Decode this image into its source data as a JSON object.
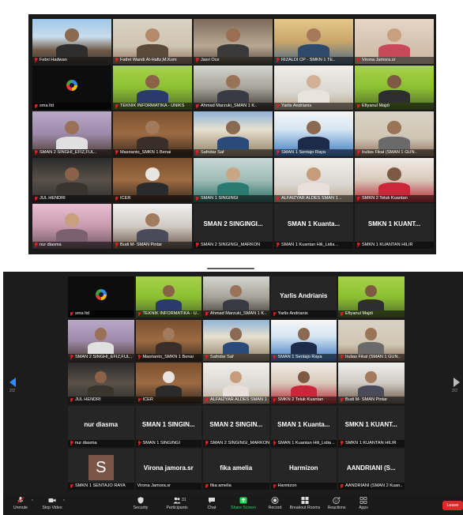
{
  "top_grid": [
    {
      "name": "Febri Hadwan",
      "muted": true,
      "type": "video",
      "bg": "bg-dock",
      "skin": "#8a6a50",
      "shirt": "#2e2e2e",
      "spotlight": true
    },
    {
      "name": "Fathri Wandi Al-Hafiz,M.Kom",
      "muted": true,
      "type": "video",
      "bg": "bg-office",
      "skin": "#b58a6a",
      "shirt": "#5a4a3a"
    },
    {
      "name": "Jasri Oce",
      "muted": true,
      "type": "video",
      "bg": "bg-room",
      "skin": "#9a6e52",
      "shirt": "#3a3a3a"
    },
    {
      "name": "RIZALDI CP - SMKN 1 TE..",
      "muted": true,
      "type": "video",
      "bg": "bg-class",
      "skin": "#a57a5a",
      "shirt": "#2d4a6a"
    },
    {
      "name": "Virona Jamora.sr",
      "muted": true,
      "type": "video",
      "bg": "bg-hijab",
      "skin": "#c9a07f",
      "shirt": "#c74a5a"
    },
    {
      "name": "sma ltd",
      "muted": true,
      "type": "logo",
      "bg": "bg-black"
    },
    {
      "name": "TEKNIK INFORMATIKA - UNIKS",
      "muted": true,
      "type": "video",
      "bg": "bg-green",
      "skin": "#8a6248",
      "shirt": "#2a3a6a"
    },
    {
      "name": "Ahmad Marzuki_SMAN 1 K..",
      "muted": true,
      "type": "video",
      "bg": "bg-photo-room",
      "skin": "#9a7258",
      "shirt": "#3a3a44"
    },
    {
      "name": "Yarlis Andrianis",
      "muted": true,
      "type": "video",
      "bg": "bg-white-room",
      "skin": "#d2b096",
      "shirt": "#e8e4dc"
    },
    {
      "name": "Efiyanul Majdi",
      "muted": true,
      "type": "video",
      "bg": "bg-green",
      "skin": "#7e5a42",
      "shirt": "#2e2e30"
    },
    {
      "name": "SMAN 2 SINGHI_EFIZ,FUL..",
      "muted": true,
      "type": "video",
      "bg": "bg-purple",
      "skin": "#9a7058",
      "shirt": "#e0e0e0"
    },
    {
      "name": "Masrianto_SMKN 1 Benai",
      "muted": true,
      "type": "video",
      "bg": "bg-wood",
      "skin": "#a27a5c",
      "shirt": "#3a2e28"
    },
    {
      "name": "Safridar Saf",
      "muted": true,
      "type": "video",
      "bg": "bg-school",
      "skin": "#8a6a52",
      "shirt": "#2a4a7a"
    },
    {
      "name": "SMAN 1 Sentajo Raya",
      "muted": true,
      "type": "video",
      "bg": "bg-slide",
      "skin": "#8c6a52",
      "shirt": "#1e2a4a"
    },
    {
      "name": "Irulias Fikal (SMAN 1 GUN..",
      "muted": true,
      "type": "video",
      "bg": "bg-office",
      "skin": "#9a7456",
      "shirt": "#6a6a6a"
    },
    {
      "name": "JUL HENDRI",
      "muted": true,
      "type": "video",
      "bg": "bg-yellow-shirt",
      "skin": "#8a6248",
      "shirt": "#3a342e"
    },
    {
      "name": "ICER",
      "muted": true,
      "type": "video",
      "bg": "bg-wood",
      "skin": "#e8e4e0",
      "shirt": "#2a2a2a"
    },
    {
      "name": "SMAN 1 SINGINGI",
      "muted": true,
      "type": "video",
      "bg": "bg-teal",
      "skin": "#c9a584",
      "shirt": "#2a7a70"
    },
    {
      "name": "ALFAIZYAR ALDES SMAN 1 ..",
      "muted": true,
      "type": "video",
      "bg": "bg-white-room",
      "skin": "#c69c7c",
      "shirt": "#e8e0d8"
    },
    {
      "name": "SMKN 2 Teluk Kuantan",
      "muted": true,
      "type": "video",
      "bg": "bg-red",
      "skin": "#7e5a44",
      "shirt": "#c8283a"
    },
    {
      "name": "nur diasma",
      "muted": true,
      "type": "video",
      "bg": "bg-pink",
      "skin": "#c9a07e",
      "shirt": "#7a6070"
    },
    {
      "name": "Budi M- SMAN Pintar",
      "muted": true,
      "type": "video",
      "bg": "bg-couple",
      "skin": "#a27a5e",
      "shirt": "#4a4a5a"
    },
    {
      "name": "SMAN 2 SINGINGI_MARKON",
      "muted": true,
      "type": "text",
      "title": "SMAN 2 SINGINGI..."
    },
    {
      "name": "SMAN 1 Kuantan Hili_Lidia ..",
      "muted": true,
      "type": "text",
      "title": "SMAN 1 Kuanta..."
    },
    {
      "name": "SMKN 1 KUANTAN HILIR",
      "muted": true,
      "type": "text",
      "title": "SMKN 1 KUANT..."
    }
  ],
  "bottom_grid": [
    {
      "name": "sma ltd",
      "muted": true,
      "type": "logo",
      "bg": "bg-black"
    },
    {
      "name": "TEKNIK INFORMATIKA - U..",
      "muted": true,
      "type": "video",
      "bg": "bg-green",
      "skin": "#8a6248",
      "shirt": "#2a3a6a"
    },
    {
      "name": "Ahmad Marzuki_SMAN 1 K..",
      "muted": true,
      "type": "video",
      "bg": "bg-photo-room",
      "skin": "#9a7258",
      "shirt": "#3a3a44"
    },
    {
      "name": "Yarlis Andrianis",
      "muted": true,
      "type": "text",
      "title": "Yarlis Andrianis"
    },
    {
      "name": "Efiyanul Majdi",
      "muted": true,
      "type": "video",
      "bg": "bg-green",
      "skin": "#7e5a42",
      "shirt": "#2e2e30"
    },
    {
      "name": "SMAN 2 SINGHI_EFIZ,FUL..",
      "muted": true,
      "type": "video",
      "bg": "bg-purple",
      "skin": "#9a7058",
      "shirt": "#e0e0e0"
    },
    {
      "name": "Masrianto_SMKN 1 Benai",
      "muted": true,
      "type": "video",
      "bg": "bg-wood",
      "skin": "#a27a5c",
      "shirt": "#3a2e28"
    },
    {
      "name": "Safridar Saf",
      "muted": true,
      "type": "video",
      "bg": "bg-school",
      "skin": "#8a6a52",
      "shirt": "#2a4a7a"
    },
    {
      "name": "SMAN 1 Sentajo Raya",
      "muted": true,
      "type": "video",
      "bg": "bg-slide",
      "skin": "#8c6a52",
      "shirt": "#1e2a4a"
    },
    {
      "name": "Irulias Fikal (SMAN 1 GUN..",
      "muted": true,
      "type": "video",
      "bg": "bg-office",
      "skin": "#9a7456",
      "shirt": "#6a6a6a"
    },
    {
      "name": "JUL HENDRI",
      "muted": true,
      "type": "video",
      "bg": "bg-yellow-shirt",
      "skin": "#8a6248",
      "shirt": "#3a342e"
    },
    {
      "name": "ICER",
      "muted": true,
      "type": "video",
      "bg": "bg-wood",
      "skin": "#e8e4e0",
      "shirt": "#2a2a2a"
    },
    {
      "name": "ALFAIZYAR ALDES SMAN 1 ..",
      "muted": true,
      "type": "video",
      "bg": "bg-white-room",
      "skin": "#c69c7c",
      "shirt": "#e8e0d8"
    },
    {
      "name": "SMKN 2 Teluk Kuantan",
      "muted": true,
      "type": "video",
      "bg": "bg-red",
      "skin": "#7e5a44",
      "shirt": "#c8283a"
    },
    {
      "name": "Budi M- SMAN Pintar",
      "muted": true,
      "type": "video",
      "bg": "bg-couple",
      "skin": "#a27a5e",
      "shirt": "#4a4a5a"
    },
    {
      "name": "nur diasma",
      "muted": true,
      "type": "text",
      "title": "nur diasma"
    },
    {
      "name": "SMAN 1 SINGINGI",
      "muted": true,
      "type": "text",
      "title": "SMAN 1 SINGIN..."
    },
    {
      "name": "SMAN 2 SINGINGI_MARKON",
      "muted": true,
      "type": "text",
      "title": "SMAN 2 SINGIN..."
    },
    {
      "name": "SMAN 1 Kuantan Hili_Lidia ..",
      "muted": true,
      "type": "text",
      "title": "SMAN 1 Kuanta..."
    },
    {
      "name": "SMKN 1 KUANTAN HILIR",
      "muted": true,
      "type": "text",
      "title": "SMKN 1 KUANT..."
    },
    {
      "name": "SMKN 1 SENTAJO RAYA",
      "muted": true,
      "type": "avatar",
      "initial": "S"
    },
    {
      "name": "Virona Jamora.sr",
      "muted": false,
      "type": "text",
      "title": "Virona jamora.sr"
    },
    {
      "name": "fika amelia",
      "muted": true,
      "type": "text",
      "title": "fika amelia"
    },
    {
      "name": "Harmizon",
      "muted": true,
      "type": "text",
      "title": "Harmizon"
    },
    {
      "name": "AANDRIANI (SMAN 2 Kuan..",
      "muted": true,
      "type": "text",
      "title": "AANDRIANI (S..."
    }
  ],
  "page_indicator": {
    "left": "2/2",
    "right": "2/2"
  },
  "toolbar": {
    "unmute": "Unmute",
    "stop_video": "Stop Video",
    "security": "Security",
    "participants": "Participants",
    "participants_count": "31",
    "chat": "Chat",
    "share_screen": "Share Screen",
    "record": "Record",
    "breakout_rooms": "Breakout Rooms",
    "reactions": "Reactions",
    "apps": "Apps",
    "leave": "Leave"
  },
  "colors": {
    "share_green": "#23d959",
    "leave_red": "#e02828",
    "mute_red": "#e02020",
    "nav_blue": "#2d8cff",
    "spotlight": "#c8e46b"
  }
}
